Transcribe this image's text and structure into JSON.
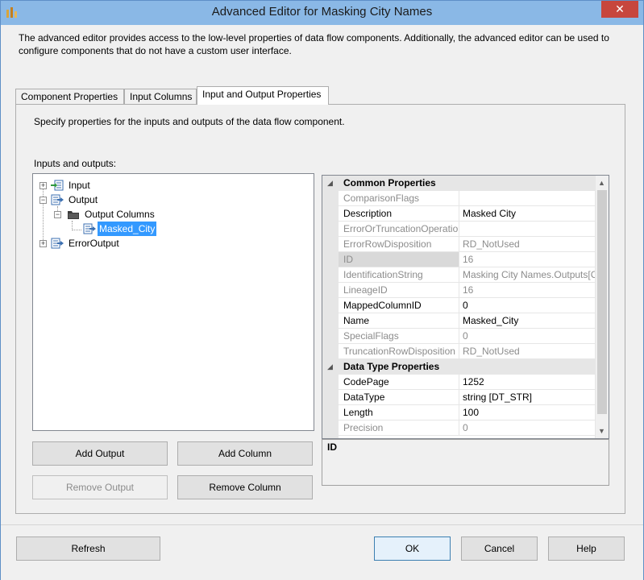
{
  "window": {
    "title": "Advanced Editor for Masking City Names",
    "close_label": "✕"
  },
  "description": "The advanced editor provides access to the low-level properties of data flow components. Additionally, the advanced editor can be used to configure components that do not have a custom user interface.",
  "tabs": [
    {
      "label": "Component Properties",
      "active": false
    },
    {
      "label": "Input Columns",
      "active": false
    },
    {
      "label": "Input and Output Properties",
      "active": true
    }
  ],
  "panel": {
    "description": "Specify properties for the inputs and outputs of the data flow component.",
    "io_label": "Inputs and outputs:"
  },
  "tree": {
    "input": "Input",
    "output": "Output",
    "output_columns": "Output Columns",
    "masked_city": "Masked_City",
    "error_output": "ErrorOutput"
  },
  "buttons": {
    "add_output": "Add Output",
    "add_column": "Add Column",
    "remove_output": "Remove Output",
    "remove_column": "Remove Column",
    "refresh": "Refresh",
    "ok": "OK",
    "cancel": "Cancel",
    "help": "Help"
  },
  "properties": {
    "common_title": "Common Properties",
    "common": [
      {
        "name": "ComparisonFlags",
        "value": "",
        "readonly": true
      },
      {
        "name": "Description",
        "value": "Masked City",
        "readonly": false
      },
      {
        "name": "ErrorOrTruncationOperatio",
        "value": "",
        "readonly": true
      },
      {
        "name": "ErrorRowDisposition",
        "value": "RD_NotUsed",
        "readonly": true
      },
      {
        "name": "ID",
        "value": "16",
        "readonly": true,
        "selected": true
      },
      {
        "name": "IdentificationString",
        "value": "Masking City Names.Outputs[C",
        "readonly": true
      },
      {
        "name": "LineageID",
        "value": "16",
        "readonly": true
      },
      {
        "name": "MappedColumnID",
        "value": "0",
        "readonly": false
      },
      {
        "name": "Name",
        "value": "Masked_City",
        "readonly": false
      },
      {
        "name": "SpecialFlags",
        "value": "0",
        "readonly": true
      },
      {
        "name": "TruncationRowDisposition",
        "value": "RD_NotUsed",
        "readonly": true
      }
    ],
    "datatype_title": "Data Type Properties",
    "datatype": [
      {
        "name": "CodePage",
        "value": "1252",
        "readonly": false
      },
      {
        "name": "DataType",
        "value": "string [DT_STR]",
        "readonly": false
      },
      {
        "name": "Length",
        "value": "100",
        "readonly": false
      },
      {
        "name": "Precision",
        "value": "0",
        "readonly": true
      }
    ]
  },
  "help": {
    "title": "ID"
  },
  "colors": {
    "titlebar": "#8ab8e6",
    "close": "#c7463d",
    "selection": "#3399ff"
  }
}
